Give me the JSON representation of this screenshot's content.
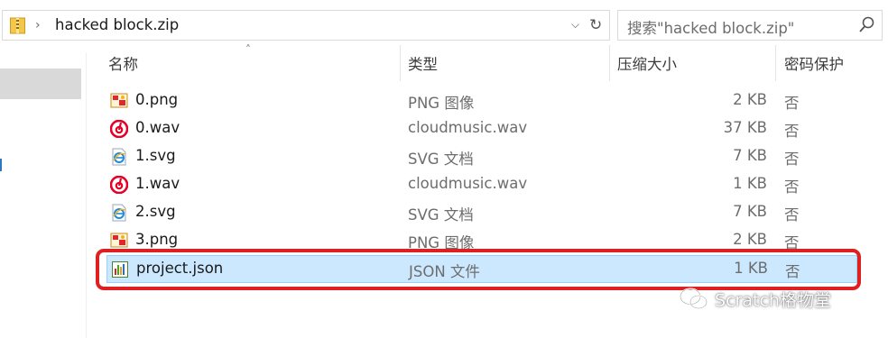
{
  "address_bar": {
    "path": "hacked block.zip",
    "separator": "›",
    "dropdown": "⌵",
    "refresh": "↻"
  },
  "search": {
    "placeholder": "搜索\"hacked block.zip\""
  },
  "columns": {
    "name": "名称",
    "type": "类型",
    "compressed_size": "压缩大小",
    "password": "密码保护",
    "sort_indicator": "˄"
  },
  "files": [
    {
      "name": "0.png",
      "type": "PNG 图像",
      "size": "2 KB",
      "protected": "否",
      "icon": "png-image-icon"
    },
    {
      "name": "0.wav",
      "type": "cloudmusic.wav",
      "size": "37 KB",
      "protected": "否",
      "icon": "cloudmusic-icon"
    },
    {
      "name": "1.svg",
      "type": "SVG 文档",
      "size": "7 KB",
      "protected": "否",
      "icon": "ie-document-icon"
    },
    {
      "name": "1.wav",
      "type": "cloudmusic.wav",
      "size": "1 KB",
      "protected": "否",
      "icon": "cloudmusic-icon"
    },
    {
      "name": "2.svg",
      "type": "SVG 文档",
      "size": "7 KB",
      "protected": "否",
      "icon": "ie-document-icon"
    },
    {
      "name": "3.png",
      "type": "PNG 图像",
      "size": "2 KB",
      "protected": "否",
      "icon": "png-image-icon"
    },
    {
      "name": "project.json",
      "type": "JSON 文件",
      "size": "1 KB",
      "protected": "否",
      "icon": "json-file-icon",
      "selected": true
    }
  ],
  "watermark": {
    "text": "Scratch格物堂",
    "icon": "wechat-icon"
  },
  "colors": {
    "selection_bg": "#cce8ff",
    "selection_border": "#99d1ff",
    "annotation_red": "#e02020",
    "netease_red": "#e60026"
  }
}
